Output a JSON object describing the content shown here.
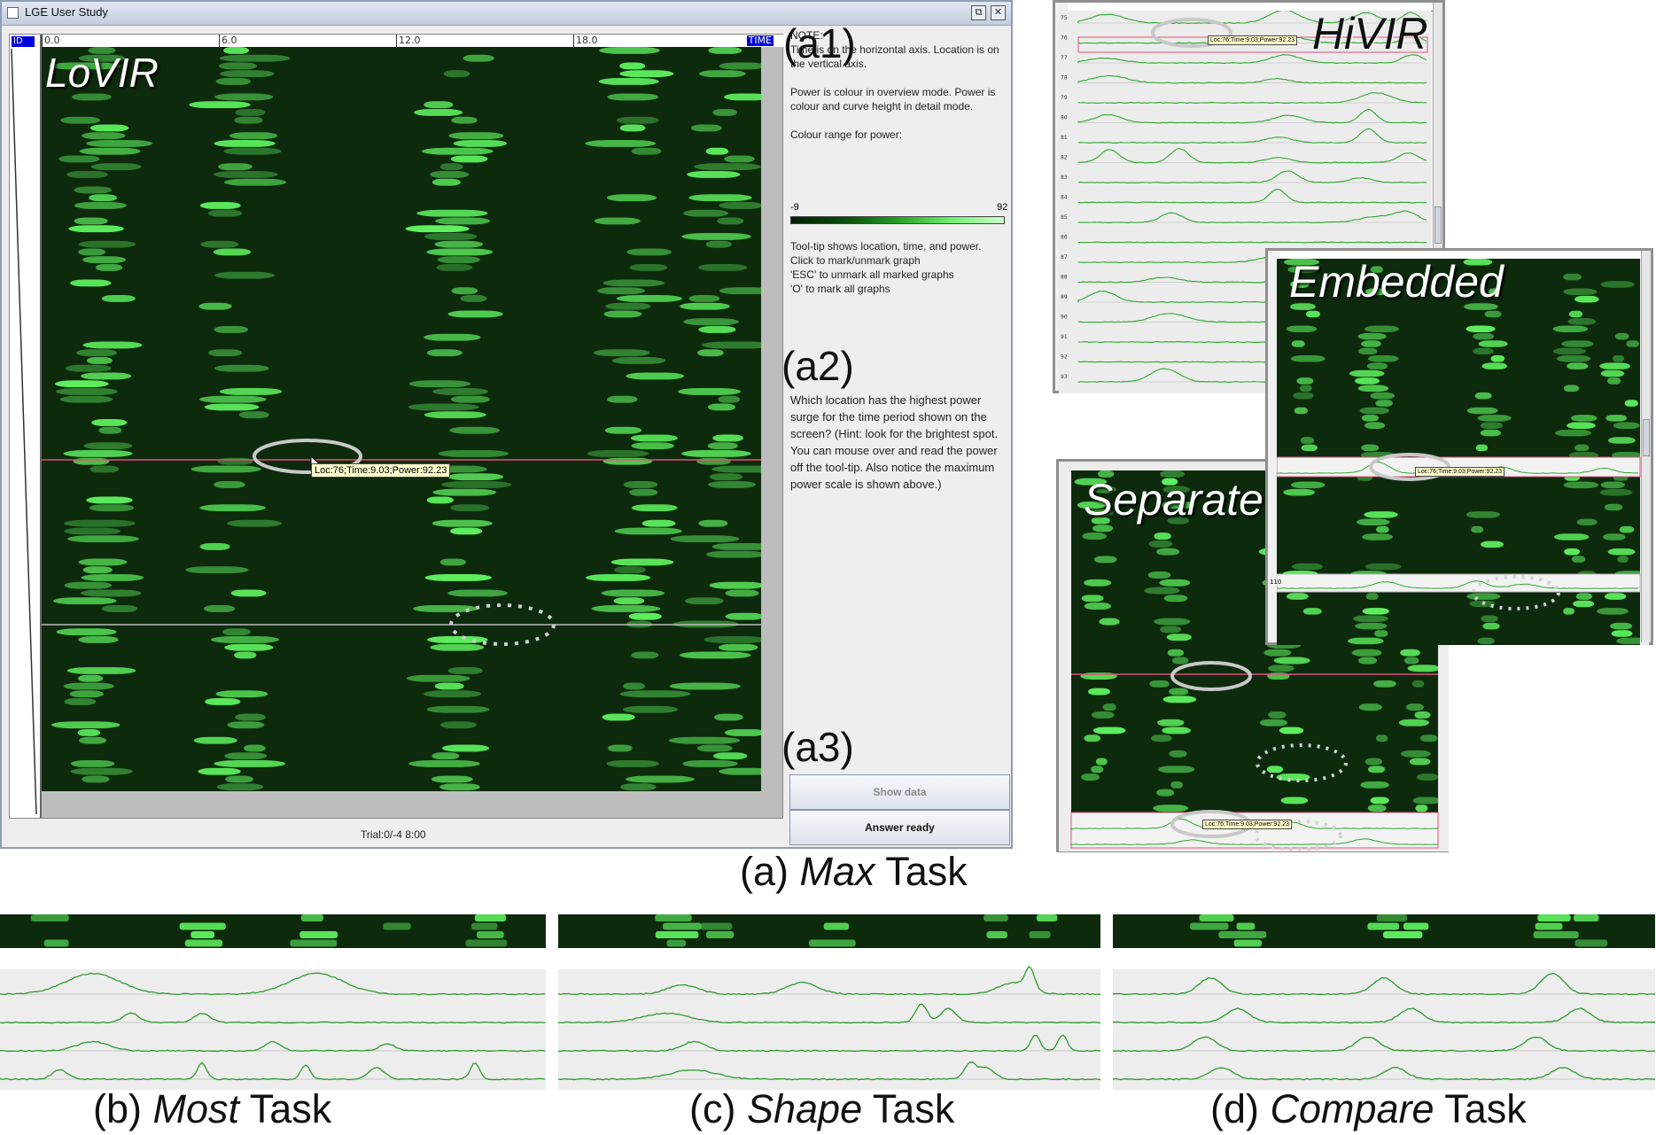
{
  "window": {
    "title": "LGE User Study",
    "restore_glyph": "⧉",
    "close_glyph": "✕"
  },
  "heatmap": {
    "id_header": "ID",
    "time_label": "TIME",
    "ticks": [
      "0.0",
      "6.0",
      "12.0",
      "18.0"
    ],
    "overlay_label": "LoVIR",
    "tooltip": "Loc:76;Time:9.03;Power:92.23"
  },
  "panel": {
    "note_title": "NOTE:",
    "note_text": "Time is on the horizontal axis.  Location is on the vertical axis.",
    "power_text": "Power is colour in overview mode.  Power is colour and curve height in detail mode.",
    "colour_range_label": "Colour range for power:",
    "range_min": "-9",
    "range_max": "92",
    "help_lines": [
      "Tool-tip shows location, time, and power.",
      "Click to mark/unmark graph",
      "'ESC' to unmark all marked graphs",
      "'O' to mark all graphs"
    ],
    "question": "Which location has the highest power surge for the time period shown on the screen?  (Hint: look for the brightest spot.  You can mouse over and read the power off the tool-tip.  Also notice the maximum power scale is shown above.)"
  },
  "annotations": {
    "a1": "(a1)",
    "a2": "(a2)",
    "a3": "(a3)"
  },
  "buttons": {
    "show_data": "Show data",
    "answer_ready": "Answer ready"
  },
  "status": "Trial:0/-4  8:00",
  "captions": {
    "a_prefix": "(a) ",
    "a_em": "Max",
    "a_suffix": " Task",
    "b_prefix": "(b) ",
    "b_em": "Most",
    "b_suffix": " Task",
    "c_prefix": "(c) ",
    "c_em": "Shape",
    "c_suffix": " Task",
    "d_prefix": "(d) ",
    "d_em": "Compare",
    "d_suffix": " Task"
  },
  "insets": {
    "hivir": {
      "label": "HiVIR",
      "row_labels": [
        "75",
        "76",
        "77",
        "78",
        "79",
        "80",
        "81",
        "82",
        "83",
        "84",
        "85",
        "86",
        "87",
        "88",
        "89",
        "90",
        "91",
        "92",
        "93"
      ],
      "tooltip": "Loc:76;Time:9.03;Power:92.23"
    },
    "embedded": {
      "label": "Embedded",
      "tooltip": "Loc:76;Time:9.03;Power:92.23",
      "row_label": "110"
    },
    "separate": {
      "label": "Separate",
      "tooltip": "Loc:76;Time:9.03;Power:92.23"
    }
  },
  "colors": {
    "heat_dark": "#0b2a0b",
    "heat_bright": "#7dfc7d",
    "marked_line": "#e0507a",
    "curve": "#2ea82e",
    "window_border": "#8d9db8"
  }
}
